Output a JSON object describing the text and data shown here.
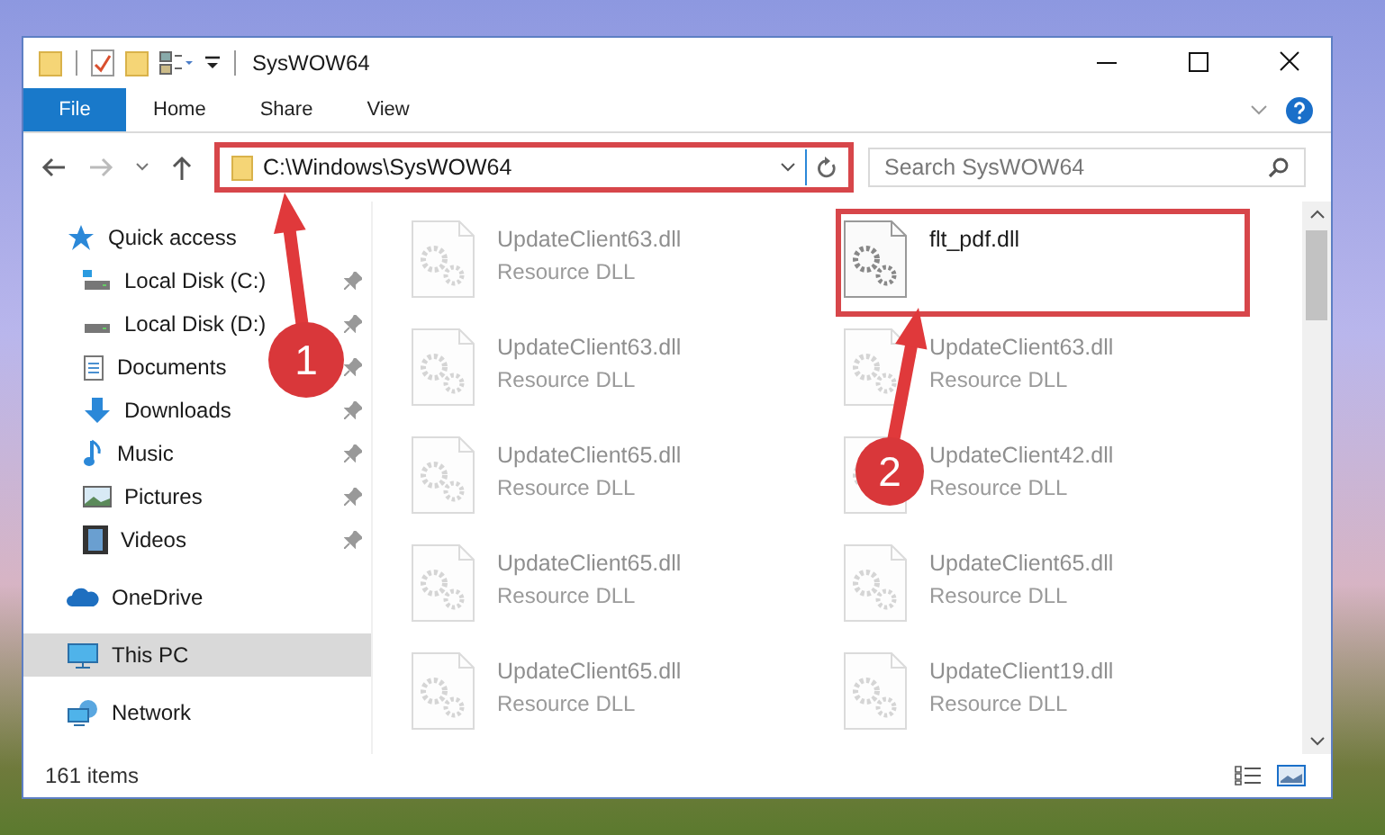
{
  "window": {
    "title": "SysWOW64"
  },
  "ribbon_tabs": [
    {
      "label": "File",
      "kind": "menu"
    },
    {
      "label": "Home",
      "kind": "tab"
    },
    {
      "label": "Share",
      "kind": "tab"
    },
    {
      "label": "View",
      "kind": "tab"
    }
  ],
  "address_bar": {
    "path": "C:\\Windows\\SysWOW64",
    "highlighted": true
  },
  "search": {
    "placeholder": "Search SysWOW64"
  },
  "navigation": [
    {
      "label": "Quick access",
      "kind": "star",
      "selected": false,
      "children": [
        {
          "label": "Local Disk (C:)",
          "kind": "drive-c",
          "pinned": true,
          "selected": false
        },
        {
          "label": "Local Disk (D:)",
          "kind": "drive",
          "pinned": true,
          "selected": false
        },
        {
          "label": "Documents",
          "kind": "document",
          "pinned": true,
          "selected": false
        },
        {
          "label": "Downloads",
          "kind": "download",
          "pinned": true,
          "selected": false
        },
        {
          "label": "Music",
          "kind": "music",
          "pinned": true,
          "selected": false
        },
        {
          "label": "Pictures",
          "kind": "picture",
          "pinned": true,
          "selected": false
        },
        {
          "label": "Videos",
          "kind": "video",
          "pinned": true,
          "selected": false
        }
      ]
    },
    {
      "label": "OneDrive",
      "kind": "cloud",
      "selected": false
    },
    {
      "label": "This PC",
      "kind": "pc",
      "selected": true
    },
    {
      "label": "Network",
      "kind": "network",
      "selected": false
    }
  ],
  "files": [
    {
      "name": "UpdateClient63.dll",
      "type": "Resource DLL",
      "highlighted": false
    },
    {
      "name": "flt_pdf.dll",
      "highlighted": true
    },
    {
      "name": "UpdateClient63.dll",
      "type": "Resource DLL",
      "highlighted": false
    },
    {
      "name": "UpdateClient63.dll",
      "type": "Resource DLL",
      "highlighted": false
    },
    {
      "name": "UpdateClient65.dll",
      "type": "Resource DLL",
      "highlighted": false
    },
    {
      "name": "UpdateClient42.dll",
      "type": "Resource DLL",
      "highlighted": false
    },
    {
      "name": "UpdateClient65.dll",
      "type": "Resource DLL",
      "highlighted": false
    },
    {
      "name": "UpdateClient65.dll",
      "type": "Resource DLL",
      "highlighted": false
    },
    {
      "name": "UpdateClient65.dll",
      "type": "Resource DLL",
      "highlighted": false
    },
    {
      "name": "UpdateClient19.dll",
      "type": "Resource DLL",
      "highlighted": false
    }
  ],
  "callouts": [
    {
      "number": "1"
    },
    {
      "number": "2"
    }
  ],
  "status_bar": {
    "item_count": "161 items"
  }
}
